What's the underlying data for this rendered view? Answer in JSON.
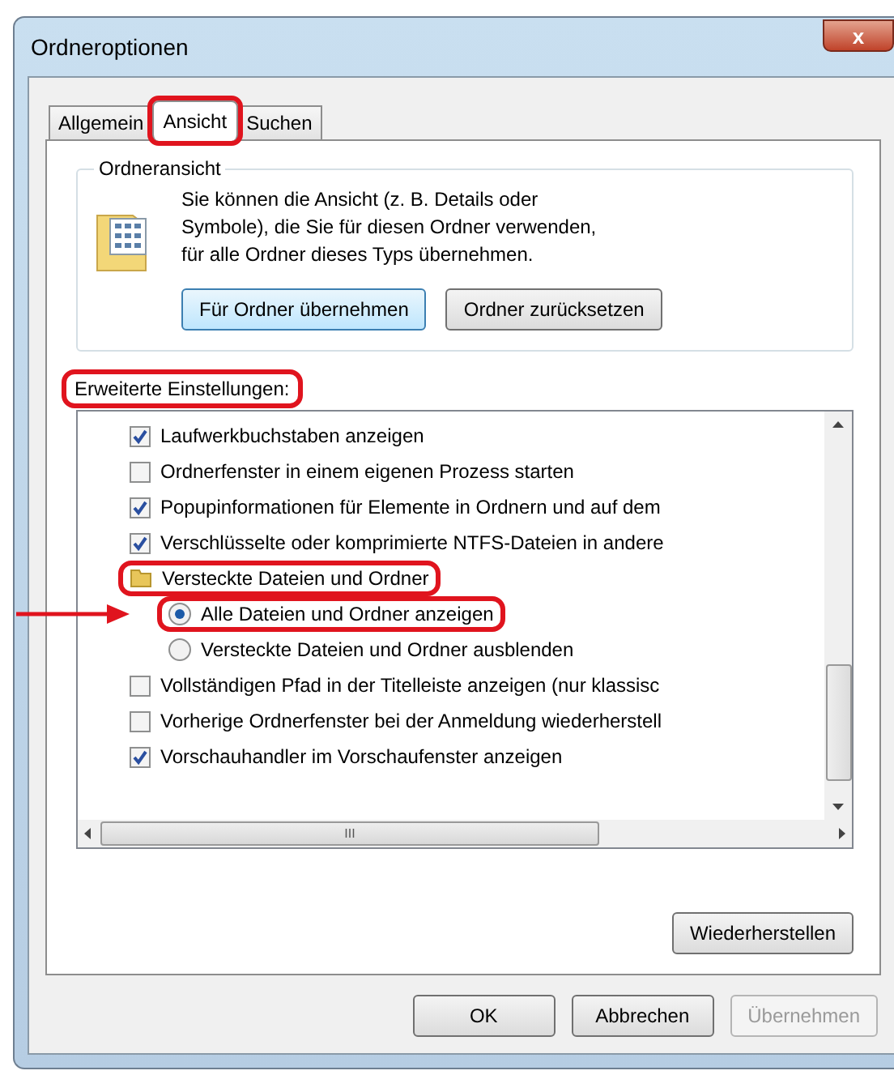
{
  "window": {
    "title": "Ordneroptionen",
    "close": "x"
  },
  "tabs": [
    {
      "label": "Allgemein",
      "selected": false,
      "highlighted": false
    },
    {
      "label": "Ansicht",
      "selected": true,
      "highlighted": true
    },
    {
      "label": "Suchen",
      "selected": false,
      "highlighted": false
    }
  ],
  "folder_view": {
    "legend": "Ordneransicht",
    "text": "Sie können die Ansicht (z. B. Details oder Symbole), die Sie für diesen Ordner verwenden, für alle Ordner dieses Typs übernehmen.",
    "buttons": [
      {
        "label": "Für Ordner übernehmen",
        "focused": true
      },
      {
        "label": "Ordner zurücksetzen",
        "focused": false
      }
    ]
  },
  "advanced": {
    "label": "Erweiterte Einstellungen:",
    "highlighted": true,
    "items": [
      {
        "kind": "checkbox",
        "label": "Laufwerkbuchstaben anzeigen",
        "checked": true,
        "highlighted": false
      },
      {
        "kind": "checkbox",
        "label": "Ordnerfenster in einem eigenen Prozess starten",
        "checked": false,
        "highlighted": false
      },
      {
        "kind": "checkbox",
        "label": "Popupinformationen für Elemente in Ordnern und auf dem",
        "checked": true,
        "highlighted": false
      },
      {
        "kind": "checkbox",
        "label": "Verschlüsselte oder komprimierte NTFS-Dateien in andere",
        "checked": true,
        "highlighted": false
      },
      {
        "kind": "folder",
        "label": "Versteckte Dateien und Ordner",
        "highlighted": true,
        "children": [
          {
            "kind": "radio",
            "label": "Alle Dateien und Ordner anzeigen",
            "selected": true,
            "highlighted": true,
            "pointer": true
          },
          {
            "kind": "radio",
            "label": "Versteckte Dateien und Ordner ausblenden",
            "selected": false,
            "highlighted": false,
            "pointer": false
          }
        ]
      },
      {
        "kind": "checkbox",
        "label": "Vollständigen Pfad in der Titelleiste anzeigen (nur klassisc",
        "checked": false,
        "highlighted": false
      },
      {
        "kind": "checkbox",
        "label": "Vorherige Ordnerfenster bei der Anmeldung wiederherstell",
        "checked": false,
        "highlighted": false
      },
      {
        "kind": "checkbox",
        "label": "Vorschauhandler im Vorschaufenster anzeigen",
        "checked": true,
        "highlighted": false
      }
    ],
    "hscroll_label": "III",
    "restore_button": "Wiederherstellen"
  },
  "buttons": [
    {
      "label": "OK",
      "disabled": false
    },
    {
      "label": "Abbrechen",
      "disabled": false
    },
    {
      "label": "Übernehmen",
      "disabled": true
    }
  ]
}
